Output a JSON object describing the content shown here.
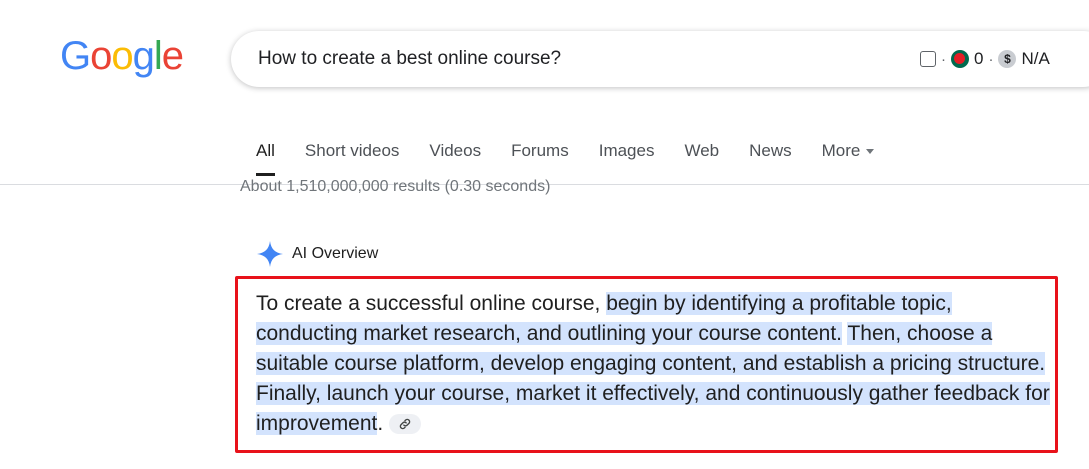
{
  "logo": {
    "letters": [
      "G",
      "o",
      "o",
      "g",
      "l",
      "e"
    ]
  },
  "colors": {
    "logo": [
      "#4285F4",
      "#EA4335",
      "#FBBC05",
      "#4285F4",
      "#34A853",
      "#EA4335"
    ],
    "highlight": "#d3e3fd",
    "annotation_box": "#e8121a",
    "ai_star": "#4285F4"
  },
  "search": {
    "query": "How to create a best online course?"
  },
  "extension": {
    "separator": "·",
    "count": "0",
    "currency_symbol": "$",
    "price": "N/A"
  },
  "tabs": [
    "All",
    "Short videos",
    "Videos",
    "Forums",
    "Images",
    "Web",
    "News",
    "More"
  ],
  "results": {
    "stats": "About 1,510,000,000 results (0.30 seconds)"
  },
  "ai_overview": {
    "title": "AI Overview",
    "icon": "sparkle-icon",
    "text_lead": "To create a successful online course, ",
    "highlight_1": "begin by identifying a profitable topic, conducting market research, and outlining your course content.",
    "gap_1": " ",
    "highlight_2": "Then, choose a suitable course platform, develop engaging content, and establish a pricing structure.",
    "gap_2": " ",
    "highlight_3": "Finally, launch your course, market it effectively, and continuously gather feedback for improvement",
    "text_end": ".",
    "link_icon": "link-icon"
  }
}
